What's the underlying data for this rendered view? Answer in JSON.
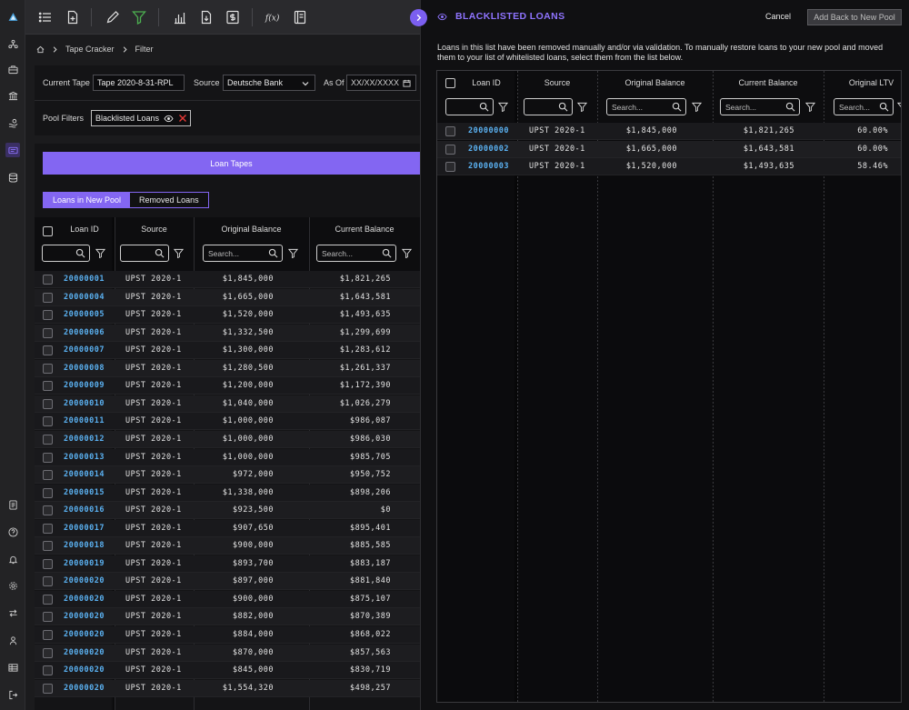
{
  "toolbar": {
    "icons": [
      "list-icon",
      "document-add-icon",
      "pencil-icon",
      "filter-icon",
      "bar-chart-icon",
      "document-download-icon",
      "dollar-document-icon",
      "function-icon",
      "notebook-icon"
    ]
  },
  "breadcrumb": {
    "items": [
      "Tape Cracker",
      "Filter"
    ]
  },
  "filters": {
    "current_tape_label": "Current Tape",
    "current_tape_value": "Tape 2020-8-31-RPL",
    "source_label": "Source",
    "source_value": "Deutsche Bank",
    "as_of_label": "As Of",
    "as_of_placeholder": "XX/XX/XXXX",
    "pool_filters_label": "Pool Filters",
    "pool_filter_chip": "Blacklisted Loans"
  },
  "main": {
    "loan_tapes_button": "Loan Tapes",
    "toggle": {
      "in_pool": "Loans in New Pool",
      "removed": "Removed Loans"
    },
    "columns": {
      "loan_id": "Loan ID",
      "source": "Source",
      "original_balance": "Original Balance",
      "current_balance": "Current Balance"
    },
    "search_placeholder": "Search...",
    "rows": [
      {
        "id": "20000001",
        "source": "UPST 2020-1",
        "orig": "$1,845,000",
        "curr": "$1,821,265"
      },
      {
        "id": "20000004",
        "source": "UPST 2020-1",
        "orig": "$1,665,000",
        "curr": "$1,643,581"
      },
      {
        "id": "20000005",
        "source": "UPST 2020-1",
        "orig": "$1,520,000",
        "curr": "$1,493,635"
      },
      {
        "id": "20000006",
        "source": "UPST 2020-1",
        "orig": "$1,332,500",
        "curr": "$1,299,699"
      },
      {
        "id": "20000007",
        "source": "UPST 2020-1",
        "orig": "$1,300,000",
        "curr": "$1,283,612"
      },
      {
        "id": "20000008",
        "source": "UPST 2020-1",
        "orig": "$1,280,500",
        "curr": "$1,261,337"
      },
      {
        "id": "20000009",
        "source": "UPST 2020-1",
        "orig": "$1,200,000",
        "curr": "$1,172,390"
      },
      {
        "id": "20000010",
        "source": "UPST 2020-1",
        "orig": "$1,040,000",
        "curr": "$1,026,279"
      },
      {
        "id": "20000011",
        "source": "UPST 2020-1",
        "orig": "$1,000,000",
        "curr": "$986,087"
      },
      {
        "id": "20000012",
        "source": "UPST 2020-1",
        "orig": "$1,000,000",
        "curr": "$986,030"
      },
      {
        "id": "20000013",
        "source": "UPST 2020-1",
        "orig": "$1,000,000",
        "curr": "$985,705"
      },
      {
        "id": "20000014",
        "source": "UPST 2020-1",
        "orig": "$972,000",
        "curr": "$950,752"
      },
      {
        "id": "20000015",
        "source": "UPST 2020-1",
        "orig": "$1,338,000",
        "curr": "$898,206"
      },
      {
        "id": "20000016",
        "source": "UPST 2020-1",
        "orig": "$923,500",
        "curr": "$0"
      },
      {
        "id": "20000017",
        "source": "UPST 2020-1",
        "orig": "$907,650",
        "curr": "$895,401"
      },
      {
        "id": "20000018",
        "source": "UPST 2020-1",
        "orig": "$900,000",
        "curr": "$885,585"
      },
      {
        "id": "20000019",
        "source": "UPST 2020-1",
        "orig": "$893,700",
        "curr": "$883,187"
      },
      {
        "id": "20000020",
        "source": "UPST 2020-1",
        "orig": "$897,000",
        "curr": "$881,840"
      },
      {
        "id": "20000020",
        "source": "UPST 2020-1",
        "orig": "$900,000",
        "curr": "$875,107"
      },
      {
        "id": "20000020",
        "source": "UPST 2020-1",
        "orig": "$882,000",
        "curr": "$870,389"
      },
      {
        "id": "20000020",
        "source": "UPST 2020-1",
        "orig": "$884,000",
        "curr": "$868,022"
      },
      {
        "id": "20000020",
        "source": "UPST 2020-1",
        "orig": "$870,000",
        "curr": "$857,563"
      },
      {
        "id": "20000020",
        "source": "UPST 2020-1",
        "orig": "$845,000",
        "curr": "$830,719"
      },
      {
        "id": "20000020",
        "source": "UPST 2020-1",
        "orig": "$1,554,320",
        "curr": "$498,257"
      }
    ]
  },
  "overlay": {
    "title": "BLACKLISTED LOANS",
    "cancel_label": "Cancel",
    "add_back_label": "Add Back to New Pool",
    "description": "Loans in this list have been removed manually and/or via validation. To manually restore loans to your new pool and moved them to your list of whitelisted loans, select them from the list below.",
    "columns": {
      "loan_id": "Loan ID",
      "source": "Source",
      "original_balance": "Original Balance",
      "current_balance": "Current Balance",
      "original_ltv": "Original LTV"
    },
    "search_placeholder": "Search...",
    "rows": [
      {
        "id": "20000000",
        "source": "UPST 2020-1",
        "orig": "$1,845,000",
        "curr": "$1,821,265",
        "ltv": "60.00%"
      },
      {
        "id": "20000002",
        "source": "UPST 2020-1",
        "orig": "$1,665,000",
        "curr": "$1,643,581",
        "ltv": "60.00%"
      },
      {
        "id": "20000003",
        "source": "UPST 2020-1",
        "orig": "$1,520,000",
        "curr": "$1,493,635",
        "ltv": "58.46%"
      }
    ]
  },
  "colors": {
    "accent": "#8366f2",
    "link": "#5ab0f0",
    "danger": "#e53935",
    "filter_active": "#4caf50"
  }
}
